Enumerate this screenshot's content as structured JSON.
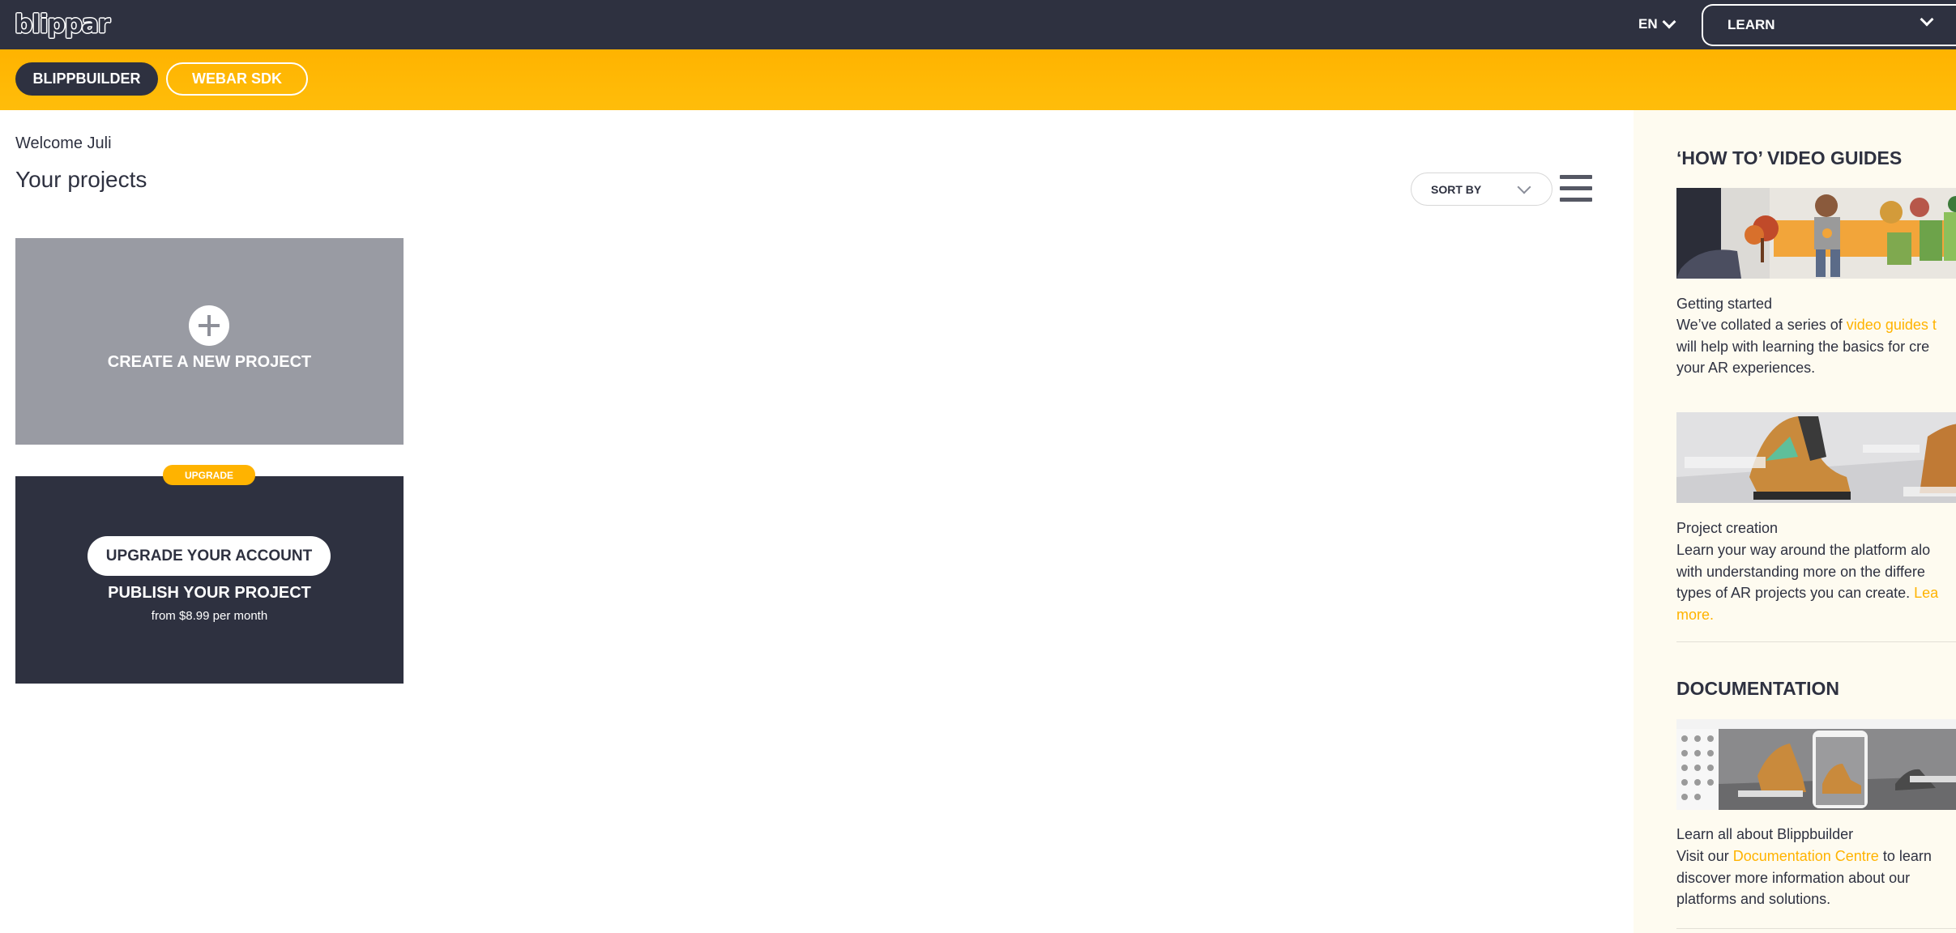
{
  "header": {
    "logo_text": "blippar",
    "language": "EN",
    "learn_label": "LEARN"
  },
  "tabs": [
    {
      "label": "BLIPPBUILDER",
      "active": true
    },
    {
      "label": "WEBAR SDK",
      "active": false
    }
  ],
  "main": {
    "welcome": "Welcome Juli",
    "heading": "Your projects",
    "sort_label": "SORT BY",
    "new_project_label": "CREATE A NEW PROJECT",
    "upgrade_badge": "UPGRADE",
    "upgrade_button": "UPGRADE YOUR ACCOUNT",
    "publish_label": "PUBLISH YOUR PROJECT",
    "price_label": "from $8.99 per month"
  },
  "sidebar": {
    "video_guides_heading": "‘HOW TO’ VIDEO GUIDES",
    "guides": [
      {
        "title": "Getting started",
        "lines": [
          [
            "We’ve collated a series of ",
            "video guides",
            " t"
          ],
          [
            "will help with learning the basics for cre"
          ],
          [
            "your AR experiences."
          ]
        ]
      },
      {
        "title": "Project creation",
        "lines": [
          [
            "Learn your way around the platform alo"
          ],
          [
            "with understanding more on the differe"
          ],
          [
            "types of AR projects you can create. ",
            "Lea"
          ],
          [
            "",
            "more."
          ]
        ]
      }
    ],
    "documentation_heading": "DOCUMENTATION",
    "doc": {
      "title": "Learn all about Blippbuilder",
      "lines": [
        [
          "Visit our ",
          "Documentation Centre",
          " to learn"
        ],
        [
          "discover more information about our"
        ],
        [
          "platforms and solutions."
        ]
      ]
    }
  },
  "colors": {
    "navy": "#2e3140",
    "accent": "#ffb300",
    "card_grey": "#999ba3",
    "panel_bg": "#fefbf0"
  }
}
